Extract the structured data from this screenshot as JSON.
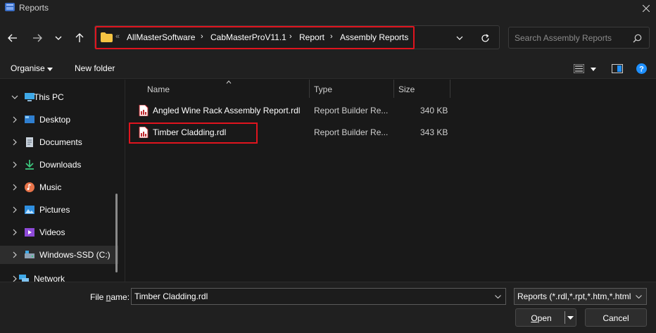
{
  "window": {
    "title": "Reports",
    "close_glyph": "✕"
  },
  "nav": {
    "back_icon": "arrow-left-icon",
    "forward_icon": "arrow-right-icon",
    "recent_icon": "chevron-down-icon",
    "up_icon": "arrow-up-icon",
    "overflow_glyph": "«",
    "breadcrumbs": [
      "AllMasterSoftware",
      "CabMasterProV11.1",
      "Report",
      "Assembly Reports"
    ],
    "sep_glyph": "›",
    "search_placeholder": "Search Assembly Reports"
  },
  "toolbar": {
    "organise": "Organise",
    "new_folder": "New folder"
  },
  "sidebar": {
    "items": [
      {
        "label": "This PC",
        "icon": "monitor-icon",
        "expanded": true
      },
      {
        "label": "Desktop",
        "icon": "desktop-icon"
      },
      {
        "label": "Documents",
        "icon": "documents-icon"
      },
      {
        "label": "Downloads",
        "icon": "download-icon"
      },
      {
        "label": "Music",
        "icon": "music-icon"
      },
      {
        "label": "Pictures",
        "icon": "pictures-icon"
      },
      {
        "label": "Videos",
        "icon": "videos-icon"
      },
      {
        "label": "Windows-SSD (C:)",
        "icon": "drive-icon",
        "selected": true
      },
      {
        "label": "Network",
        "icon": "network-icon"
      }
    ]
  },
  "files": {
    "columns": {
      "name": "Name",
      "type": "Type",
      "size": "Size"
    },
    "rows": [
      {
        "name": "Angled Wine Rack Assembly Report.rdl",
        "type": "Report Builder Re...",
        "size": "340 KB"
      },
      {
        "name": "Timber Cladding.rdl",
        "type": "Report Builder Re...",
        "size": "343 KB"
      }
    ]
  },
  "bottom": {
    "file_name_label_prefix": "File ",
    "file_name_label_underlined": "n",
    "file_name_label_suffix": "ame:",
    "file_name_value": "Timber Cladding.rdl",
    "filter_value": "Reports (*.rdl,*.rpt,*.htm,*.html",
    "open_underlined": "O",
    "open_rest": "pen",
    "cancel": "Cancel"
  },
  "colors": {
    "highlight_red": "#e0141e",
    "folder_yellow": "#f5c443",
    "accent_blue": "#1e90ff",
    "rdl_red": "#c0282d"
  }
}
